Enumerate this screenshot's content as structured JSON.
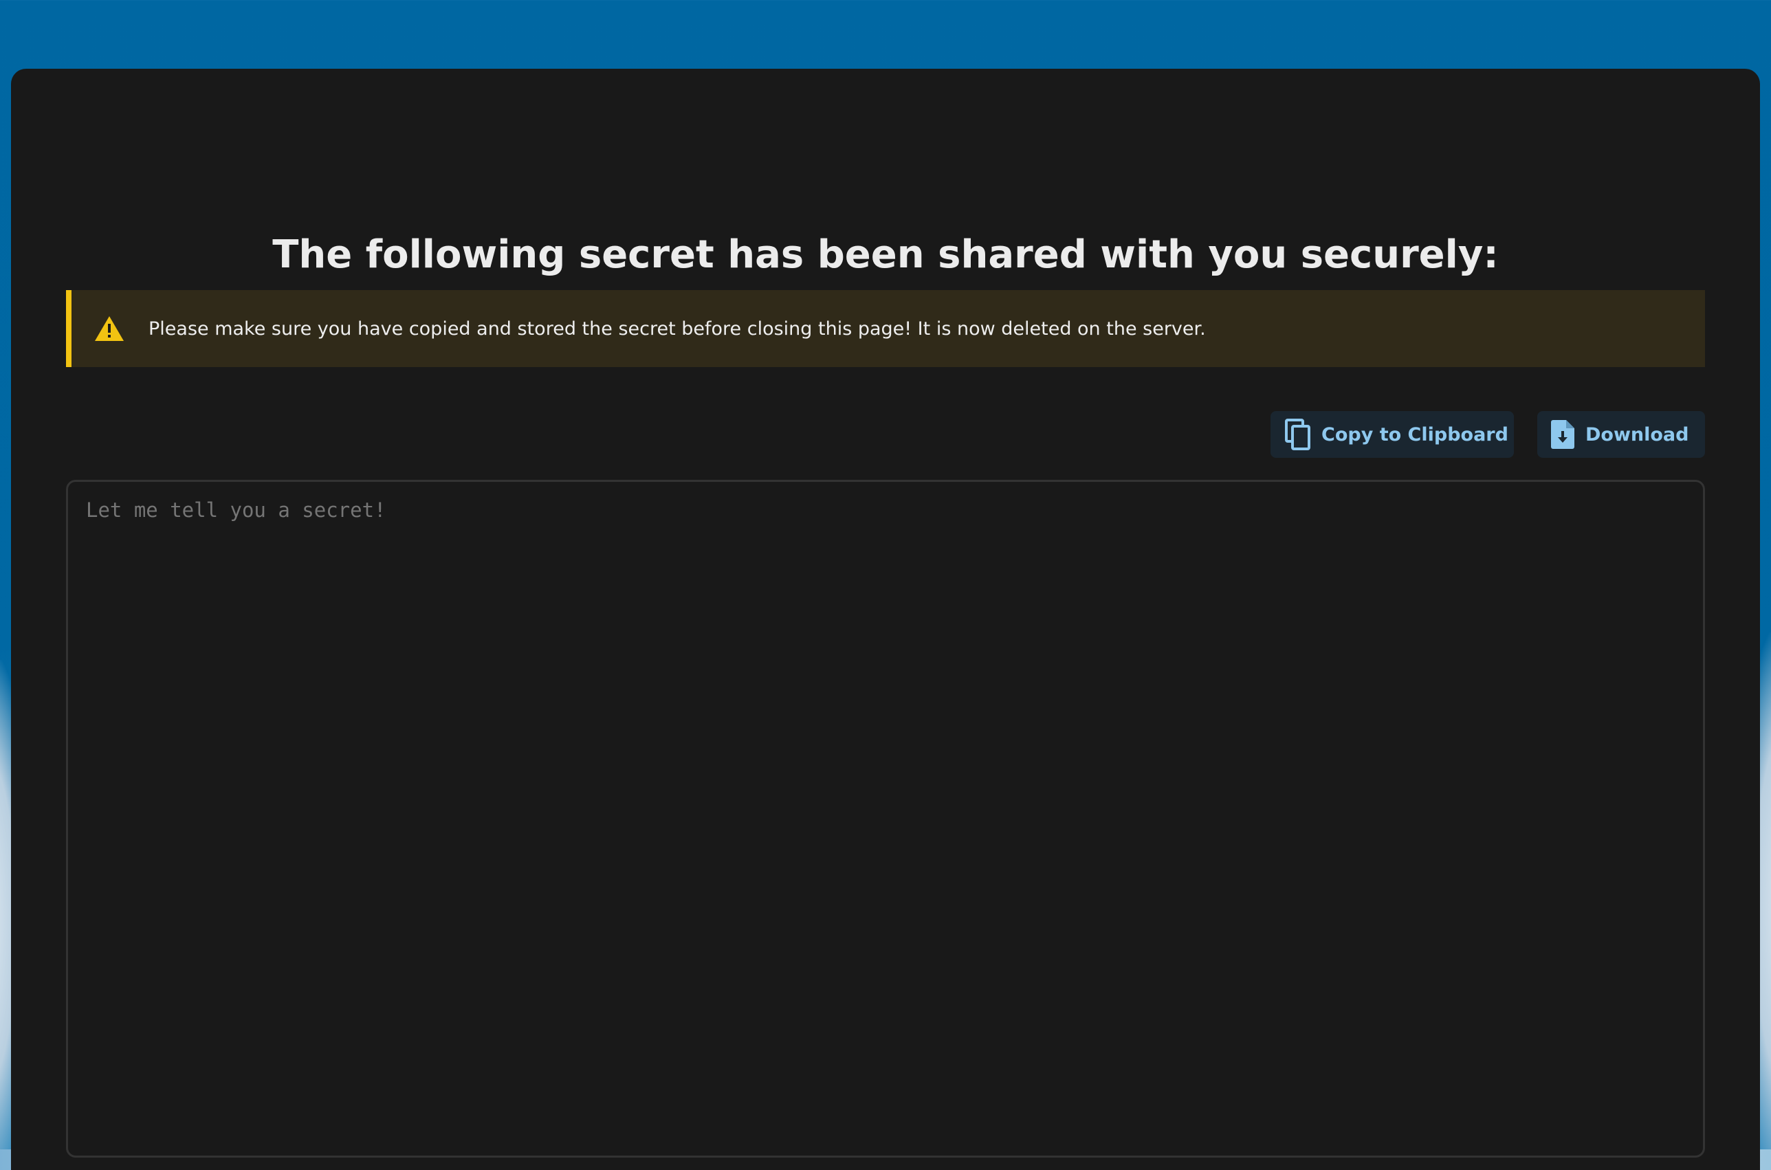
{
  "page": {
    "title": "The following secret has been shared with you securely:"
  },
  "warning": {
    "text": "Please make sure you have copied and stored the secret before closing this page! It is now deleted on the server.",
    "icon": "warning-triangle-icon",
    "accent_color": "#f2c312"
  },
  "toolbar": {
    "copy_label": "Copy to Clipboard",
    "copy_icon": "copy-icon",
    "download_label": "Download",
    "download_icon": "file-download-icon",
    "button_text_color": "#8ec8ee"
  },
  "secret": {
    "value": "",
    "placeholder": "Let me tell you a secret!"
  },
  "colors": {
    "background": "#0067a2",
    "panel": "#191919"
  }
}
